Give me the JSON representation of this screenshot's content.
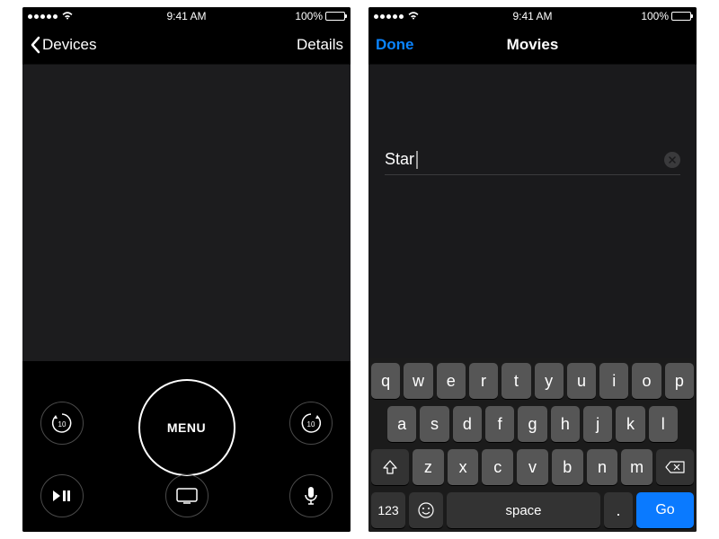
{
  "status": {
    "time": "9:41 AM",
    "battery_pct": "100%"
  },
  "left": {
    "nav_back_label": "Devices",
    "nav_right_label": "Details",
    "menu_label": "MENU",
    "skip_back_seconds": "10",
    "skip_fwd_seconds": "10"
  },
  "right": {
    "done_label": "Done",
    "nav_title": "Movies",
    "search_value": "Star",
    "keyboard": {
      "row1": [
        "q",
        "w",
        "e",
        "r",
        "t",
        "y",
        "u",
        "i",
        "o",
        "p"
      ],
      "row2": [
        "a",
        "s",
        "d",
        "f",
        "g",
        "h",
        "j",
        "k",
        "l"
      ],
      "row3": [
        "z",
        "x",
        "c",
        "v",
        "b",
        "n",
        "m"
      ],
      "numbers_label": "123",
      "space_label": "space",
      "period_label": ".",
      "go_label": "Go"
    }
  }
}
